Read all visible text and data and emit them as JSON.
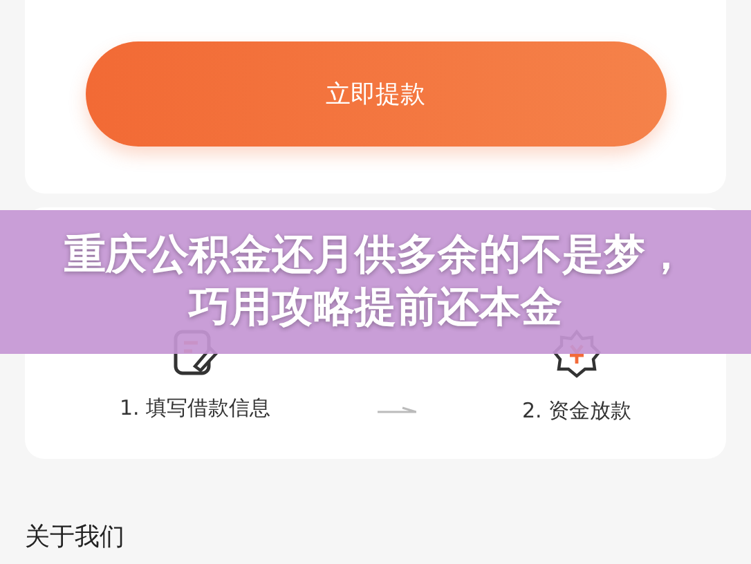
{
  "withdraw_button": {
    "label": "立即提款"
  },
  "steps": [
    {
      "label": "1. 填写借款信息",
      "kind": "form"
    },
    {
      "label": "2. 资金放款",
      "kind": "money"
    }
  ],
  "about": {
    "title": "关于我们"
  },
  "banner": {
    "title": "重庆公积金还月供多余的不是梦，巧用攻略提前还本金"
  }
}
